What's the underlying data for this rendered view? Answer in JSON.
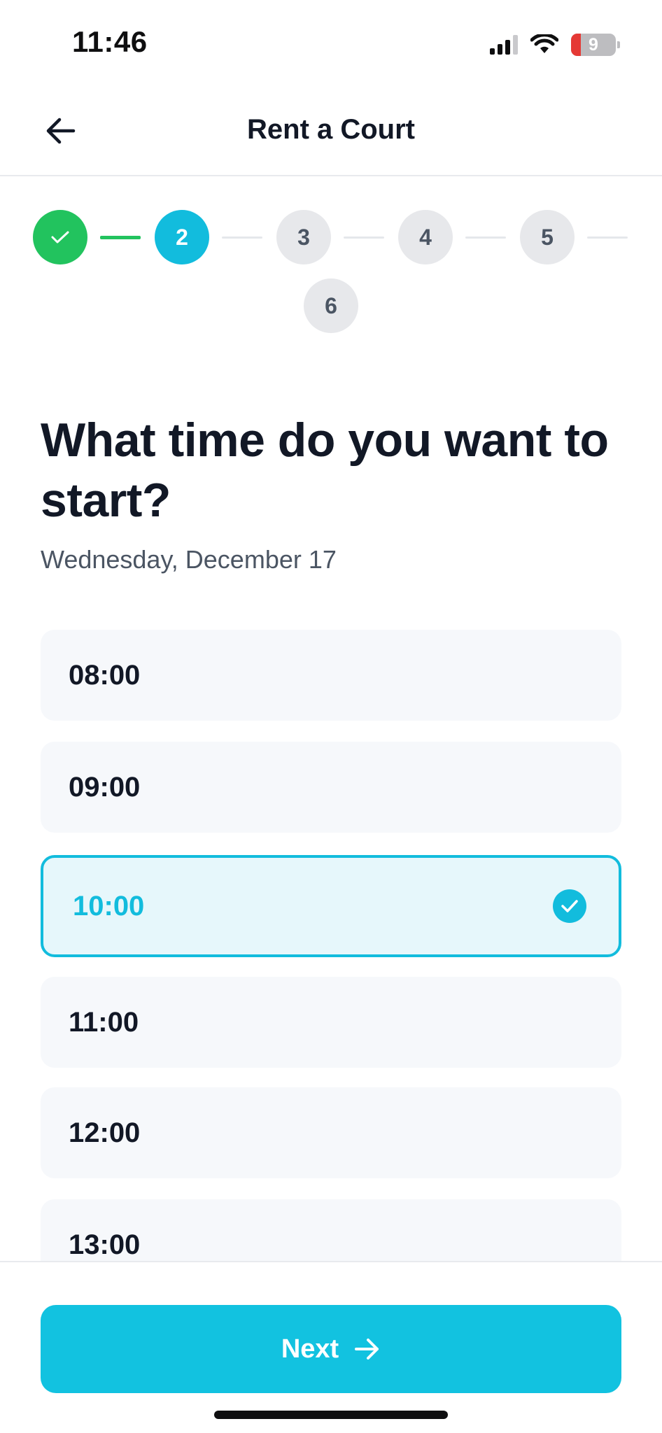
{
  "status_bar": {
    "time": "11:46",
    "battery": "9"
  },
  "header": {
    "title": "Rent a Court"
  },
  "stepper": {
    "steps": [
      {
        "label": "",
        "state": "done"
      },
      {
        "label": "2",
        "state": "active"
      },
      {
        "label": "3",
        "state": "todo"
      },
      {
        "label": "4",
        "state": "todo"
      },
      {
        "label": "5",
        "state": "todo"
      },
      {
        "label": "6",
        "state": "todo"
      }
    ]
  },
  "question": {
    "title": "What time do you want to start?",
    "date": "Wednesday, December 17"
  },
  "slots": [
    {
      "label": "08:00",
      "selected": false
    },
    {
      "label": "09:00",
      "selected": false
    },
    {
      "label": "10:00",
      "selected": true
    },
    {
      "label": "11:00",
      "selected": false
    },
    {
      "label": "12:00",
      "selected": false
    },
    {
      "label": "13:00",
      "selected": false
    }
  ],
  "footer": {
    "next_label": "Next"
  },
  "colors": {
    "accent": "#12bcdd",
    "done": "#22c35e",
    "text": "#121826",
    "muted": "#4b5563"
  }
}
